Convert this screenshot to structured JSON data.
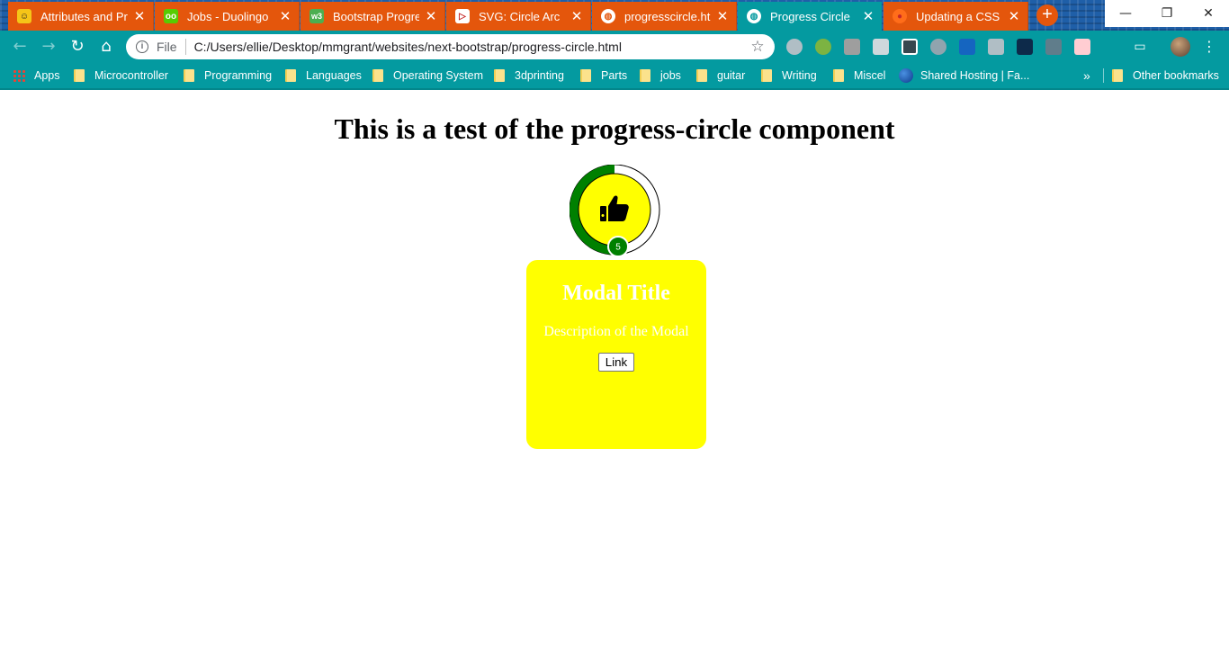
{
  "browser": {
    "tabs": [
      {
        "title": "Attributes and Pro",
        "icon": "smiley-favicon-icon",
        "icon_color": "#f5c518",
        "icon_glyph": "☺",
        "active": false
      },
      {
        "title": "Jobs - Duolingo",
        "icon": "duolingo-owl-icon",
        "icon_color": "#58cc02",
        "icon_glyph": "oo",
        "active": false
      },
      {
        "title": "Bootstrap Progress",
        "icon": "w3schools-icon",
        "icon_color": "#4caf50",
        "icon_glyph": "w3",
        "active": false
      },
      {
        "title": "SVG: Circle Arc",
        "icon": "svg-favicon-icon",
        "icon_color": "#c62828",
        "icon_glyph": "▷",
        "active": false
      },
      {
        "title": "progresscircle.htm",
        "icon": "globe-icon",
        "icon_color": "#ffffff",
        "icon_glyph": "◍",
        "active": false
      },
      {
        "title": "Progress Circle",
        "icon": "globe-icon",
        "icon_color": "#ffffff",
        "icon_glyph": "◍",
        "active": true
      },
      {
        "title": "Updating a CSS Va",
        "icon": "firefox-icon",
        "icon_color": "#ff6d1a",
        "icon_glyph": "●",
        "active": false
      }
    ],
    "new_tab_label": "+",
    "window_controls": {
      "minimize": "—",
      "restore": "❐",
      "close": "✕"
    },
    "address_bar": {
      "scheme_label": "File",
      "url": "C:/Users/ellie/Desktop/mmgrant/websites/next-bootstrap/progress-circle.html"
    },
    "extensions": [
      "ext-1-icon",
      "ext-2-icon",
      "ext-3-icon",
      "ext-4-icon",
      "ext-5-icon",
      "ext-6-icon",
      "ext-7-icon",
      "ext-8-icon",
      "ext-9-icon",
      "ext-10-icon",
      "ext-11-icon"
    ],
    "bookmarks": [
      {
        "label": "Apps",
        "type": "apps"
      },
      {
        "label": "Microcontroller",
        "type": "folder"
      },
      {
        "label": "Programming",
        "type": "folder"
      },
      {
        "label": "Languages",
        "type": "folder"
      },
      {
        "label": "Operating System",
        "type": "folder"
      },
      {
        "label": "3dprinting",
        "type": "folder"
      },
      {
        "label": "Parts",
        "type": "folder"
      },
      {
        "label": "jobs",
        "type": "folder"
      },
      {
        "label": "guitar",
        "type": "folder"
      },
      {
        "label": "Writing",
        "type": "folder"
      },
      {
        "label": "Miscel",
        "type": "folder"
      },
      {
        "label": "Shared Hosting | Fa...",
        "type": "site"
      }
    ],
    "bookmarks_overflow": "»",
    "other_bookmarks": "Other bookmarks"
  },
  "page": {
    "heading": "This is a test of the progress-circle component",
    "progress_circle": {
      "progress": 0.5,
      "badge": "5",
      "icon": "thumbs-up-icon",
      "ring_color": "#008000",
      "center_color": "#ffff00"
    },
    "modal": {
      "title": "Modal Title",
      "description": "Description of the Modal",
      "link_label": "Link",
      "background": "#ffff00"
    }
  }
}
